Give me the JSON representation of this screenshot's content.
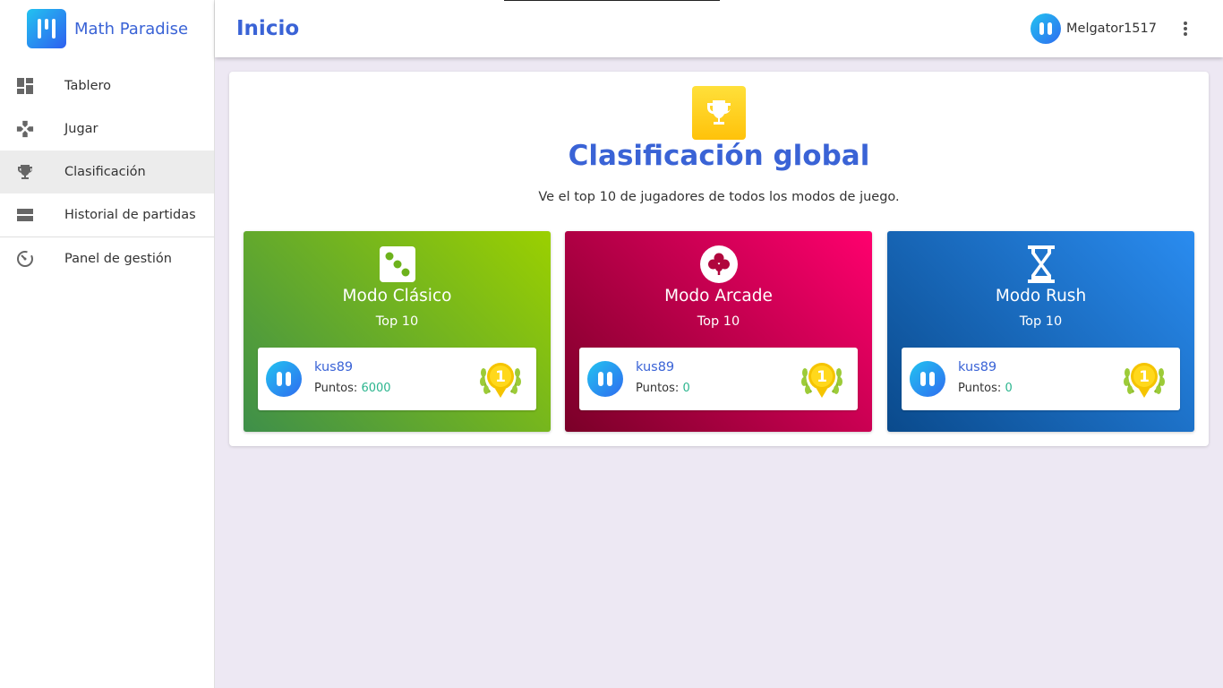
{
  "app": {
    "name": "Math Paradise"
  },
  "header": {
    "title": "Inicio",
    "username": "Melgator1517"
  },
  "sidebar": {
    "items": [
      {
        "label": "Tablero",
        "icon": "dashboard-icon"
      },
      {
        "label": "Jugar",
        "icon": "gamepad-icon"
      },
      {
        "label": "Clasificación",
        "icon": "trophy-icon",
        "active": true
      },
      {
        "label": "Historial de partidas",
        "icon": "history-icon"
      },
      {
        "label": "Panel de gestión",
        "icon": "timer-icon"
      }
    ]
  },
  "leaderboard": {
    "title": "Clasificación global",
    "subtitle": "Ve el top 10 de jugadores de todos los modos de juego.",
    "modes": [
      {
        "title": "Modo Clásico",
        "subtitle": "Top 10",
        "icon": "dice-icon",
        "gradient": [
          "#3e8f4a",
          "#9bd000"
        ],
        "player": "kus89",
        "points_label": "Puntos:",
        "points": "6000",
        "rank": "1"
      },
      {
        "title": "Modo Arcade",
        "subtitle": "Top 10",
        "icon": "clover-icon",
        "gradient": [
          "#8a0030",
          "#f8006a"
        ],
        "player": "kus89",
        "points_label": "Puntos:",
        "points": "0",
        "rank": "1"
      },
      {
        "title": "Modo Rush",
        "subtitle": "Top 10",
        "icon": "hourglass-icon",
        "gradient": [
          "#0a4a8c",
          "#2a8cf0"
        ],
        "player": "kus89",
        "points_label": "Puntos:",
        "points": "0",
        "rank": "1"
      }
    ]
  },
  "colors": {
    "accent": "#3a63d6",
    "points": "#2bb58e",
    "trophy": "#ffc20a",
    "medal": "#f5c400"
  }
}
